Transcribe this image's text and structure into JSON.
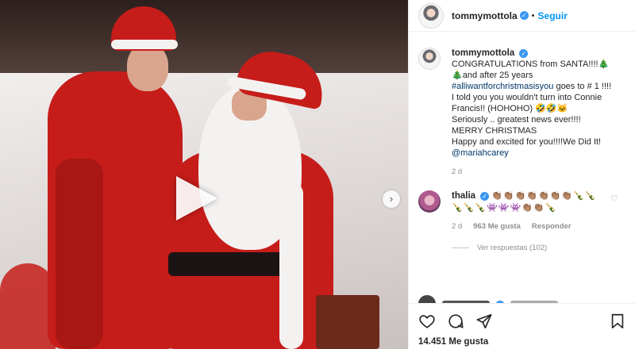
{
  "post": {
    "username": "tommymottola",
    "follow_label": "Seguir",
    "separator": "•"
  },
  "caption": {
    "username": "tommymottola",
    "line1": "CONGRATULATIONS from SANTA!!!!",
    "line2": "and after 25 years",
    "hashtag": "#alliwantforchristmasisyou",
    "line3": " goes to # 1 !!!!",
    "line4": "I told you you wouldn't turn into Connie Francis!! (HOHOHO)",
    "line5": "Seriously .. greatest news ever!!!!",
    "line6": "MERRY CHRISTMAS",
    "line7": "Happy and excited for you!!!!We Did It!",
    "mention": "@mariahcarey",
    "time": "2 d"
  },
  "comment": {
    "username": "thalia",
    "emoji_text": "👏🏽👏🏽👏🏽👏🏽👏🏽👏🏽👏🏽🍾🍾🍾🍾🍾👾👾👾👏🏽👏🏽🍾",
    "time": "2 d",
    "likes": "963 Me gusta",
    "reply_label": "Responder",
    "view_replies": "Ver respuestas (102)"
  },
  "footer": {
    "likes": "14.451 Me gusta"
  },
  "icons": {
    "verified": "verified-badge-icon",
    "play": "play-icon",
    "next": "chevron-right-icon",
    "like": "heart-icon",
    "comment": "comment-icon",
    "share": "share-icon",
    "save": "bookmark-icon"
  },
  "colors": {
    "accent": "#0095f6",
    "verified": "#3897f0",
    "link": "#00376b",
    "muted": "#8e8e8e"
  }
}
